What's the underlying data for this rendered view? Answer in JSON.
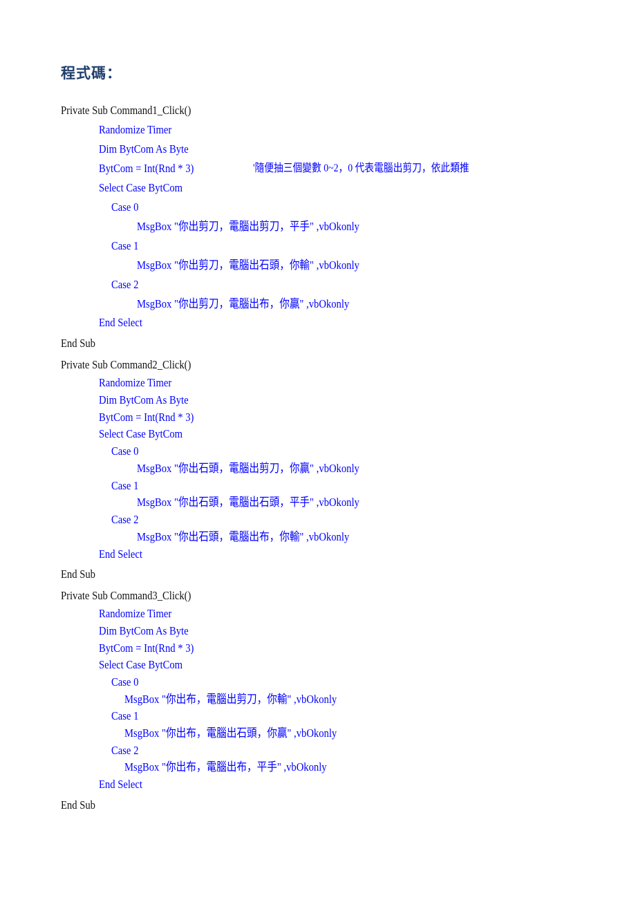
{
  "heading": "程式碼：",
  "colors": {
    "keyword_text": "#0000ff",
    "plain_text": "#111111",
    "heading": "#1f3e6b"
  },
  "code": {
    "sub1": {
      "header": "Private Sub Command1_Click()",
      "randomize": "Randomize Timer",
      "dim": "Dim BytCom As Byte",
      "assign": "BytCom = Int(Rnd * 3)",
      "comment": "'隨便抽三個變數 0~2，0 代表電腦出剪刀，依此類推",
      "select": "Select Case BytCom",
      "case0": "Case 0",
      "msg0": "MsgBox \"你出剪刀，電腦出剪刀，平手\" ,vbOkonly",
      "case1": "Case 1",
      "msg1": "MsgBox \"你出剪刀，電腦出石頭，你輸\" ,vbOkonly",
      "case2": "Case 2",
      "msg2": "MsgBox \"你出剪刀，電腦出布，你贏\" ,vbOkonly",
      "end_select": "End Select",
      "end_sub": "End Sub"
    },
    "sub2": {
      "header": "Private Sub Command2_Click()",
      "randomize": "Randomize Timer",
      "dim": "Dim BytCom As Byte",
      "assign": "BytCom = Int(Rnd * 3)",
      "select": "Select Case BytCom",
      "case0": "Case 0",
      "msg0": "MsgBox \"你出石頭，電腦出剪刀，你贏\" ,vbOkonly",
      "case1": "Case 1",
      "msg1": "MsgBox \"你出石頭，電腦出石頭，平手\" ,vbOkonly",
      "case2": "Case 2",
      "msg2": "MsgBox \"你出石頭，電腦出布，你輸\" ,vbOkonly",
      "end_select": "End Select",
      "end_sub": "End Sub"
    },
    "sub3": {
      "header": "Private Sub Command3_Click()",
      "randomize": "Randomize Timer",
      "dim": "Dim BytCom As Byte",
      "assign": "BytCom = Int(Rnd * 3)",
      "select": "Select Case BytCom",
      "case0": "Case 0",
      "msg0": "MsgBox \"你出布，電腦出剪刀，你輸\" ,vbOkonly",
      "case1": "Case 1",
      "msg1": "MsgBox \"你出布，電腦出石頭，你贏\" ,vbOkonly",
      "case2": "Case 2",
      "msg2": "MsgBox \"你出布，電腦出布，平手\" ,vbOkonly",
      "end_select": "End Select",
      "end_sub": "End Sub"
    }
  }
}
